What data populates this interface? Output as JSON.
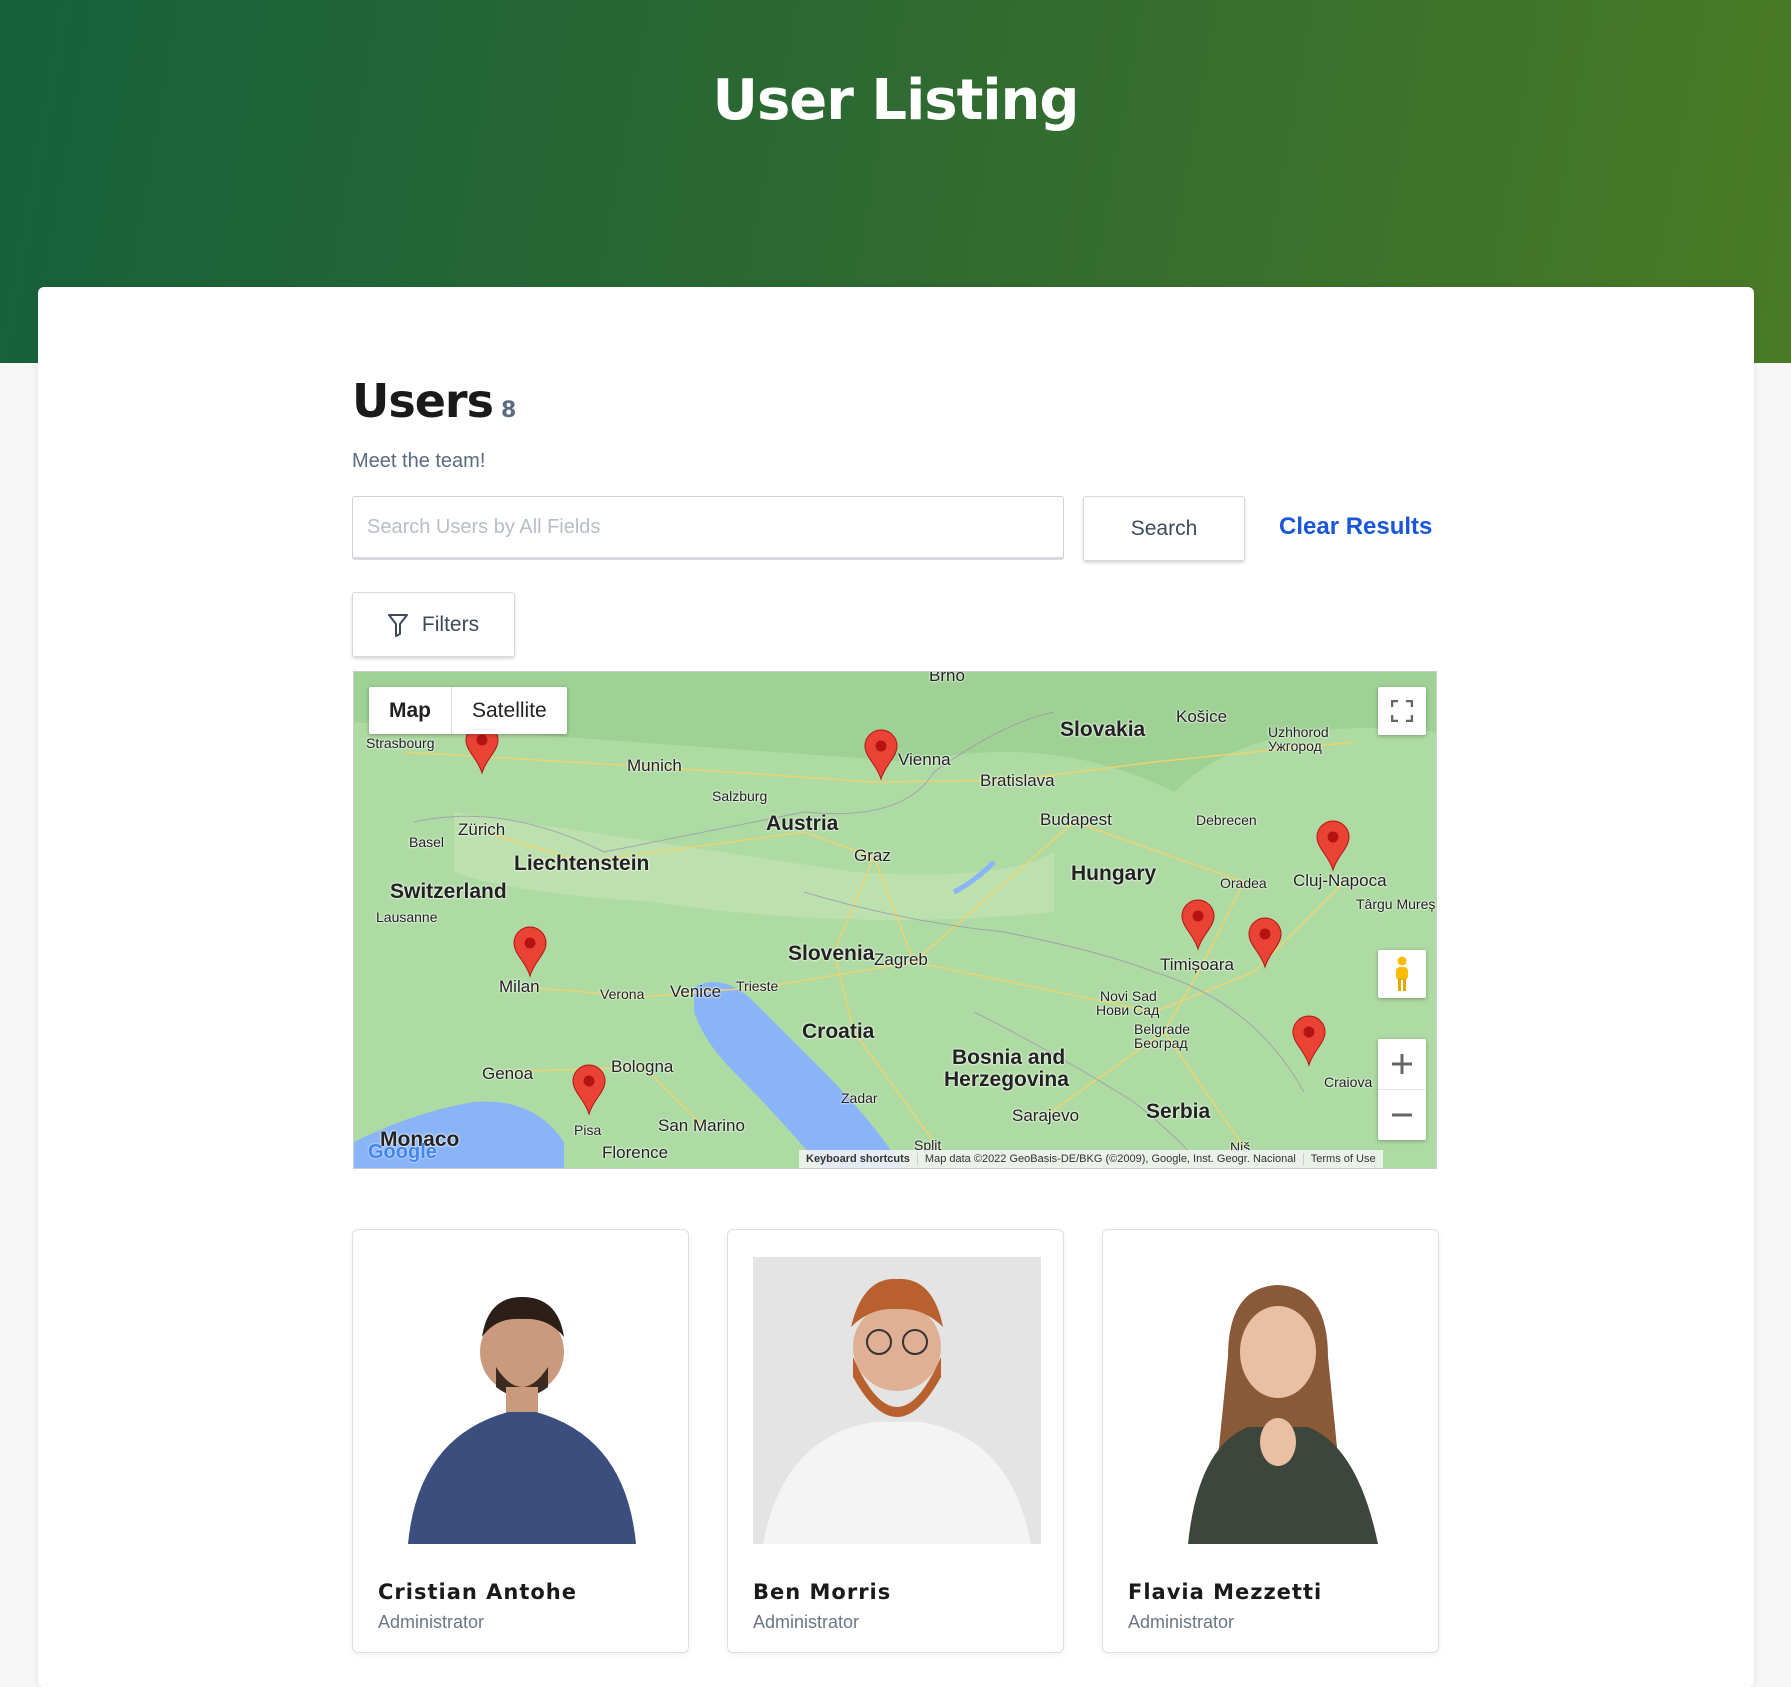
{
  "header": {
    "title": "User Listing"
  },
  "users_section": {
    "title": "Users",
    "count": "8",
    "subtitle": "Meet the team!"
  },
  "search": {
    "placeholder": "Search Users by All Fields",
    "value": "",
    "button_label": "Search",
    "clear_label": "Clear Results"
  },
  "filters": {
    "label": "Filters",
    "icon": "filter-icon"
  },
  "map": {
    "type_options": [
      "Map",
      "Satellite"
    ],
    "selected_type": "Map",
    "labels": [
      "Brno",
      "Strasbourg",
      "Munich",
      "Salzburg",
      "Vienna",
      "Bratislava",
      "Slovakia",
      "Košice",
      "Uzhhorod",
      "Ужгород",
      "Zürich",
      "Basel",
      "Liechtenstein",
      "Austria",
      "Graz",
      "Budapest",
      "Debrecen",
      "Switzerland",
      "Lausanne",
      "Hungary",
      "Oradea",
      "Cluj-Napoca",
      "Târgu Mureș",
      "Slovenia",
      "Zagreb",
      "Timișoara",
      "Milan",
      "Verona",
      "Venice",
      "Trieste",
      "Novi Sad",
      "Нови Сад",
      "Belgrade",
      "Београд",
      "Croatia",
      "Bosnia and",
      "Herzegovina",
      "Genoa",
      "Bologna",
      "Craiova",
      "Zadar",
      "Sarajevo",
      "Serbia",
      "San Marino",
      "Pisa",
      "Monaco",
      "Florence",
      "Split",
      "Niš"
    ],
    "marker_count": 8,
    "marker_color": "#ea4335",
    "logo": "Google",
    "footer": [
      "Keyboard shortcuts",
      "Map data ©2022 GeoBasis-DE/BKG (©2009), Google, Inst. Geogr. Nacional",
      "Terms of Use"
    ]
  },
  "users": [
    {
      "name": "Cristian Antohe",
      "role": "Administrator"
    },
    {
      "name": "Ben Morris",
      "role": "Administrator"
    },
    {
      "name": "Flavia Mezzetti",
      "role": "Administrator"
    }
  ],
  "colors": {
    "header_start": "#17613a",
    "header_end": "#4a7a25",
    "link": "#1a56db"
  }
}
